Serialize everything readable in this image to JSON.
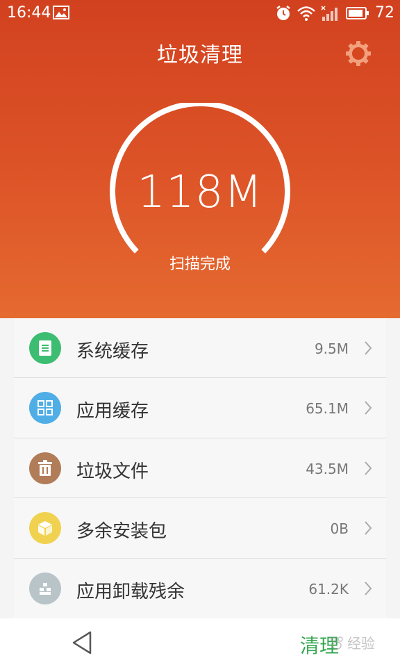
{
  "status_bar": {
    "time": "16:44",
    "battery": "72",
    "icons": [
      "image-icon",
      "alarm-icon",
      "wifi-icon",
      "signal-icon",
      "battery-icon"
    ]
  },
  "header": {
    "title": "垃圾清理",
    "settings_icon": "gear-icon"
  },
  "gauge": {
    "value": "118M",
    "status": "扫描完成"
  },
  "items": [
    {
      "label": "系统缓存",
      "size": "9.5M",
      "icon": "document-icon",
      "color": "#3dbd71"
    },
    {
      "label": "应用缓存",
      "size": "65.1M",
      "icon": "grid-icon",
      "color": "#4faee6"
    },
    {
      "label": "垃圾文件",
      "size": "43.5M",
      "icon": "trash-icon",
      "color": "#b17d59"
    },
    {
      "label": "多余安装包",
      "size": "0B",
      "icon": "package-icon",
      "color": "#f0d250"
    },
    {
      "label": "应用卸载残余",
      "size": "61.2K",
      "icon": "residue-icon",
      "color": "#b9c4c9"
    }
  ],
  "bottom_bar": {
    "back_icon": "back-triangle-icon",
    "clean_label": "清理"
  },
  "watermark": {
    "text": "经验"
  },
  "colors": {
    "hero_top": "#d2411f",
    "hero_bottom": "#e56a30",
    "accent_green": "#35a852"
  }
}
